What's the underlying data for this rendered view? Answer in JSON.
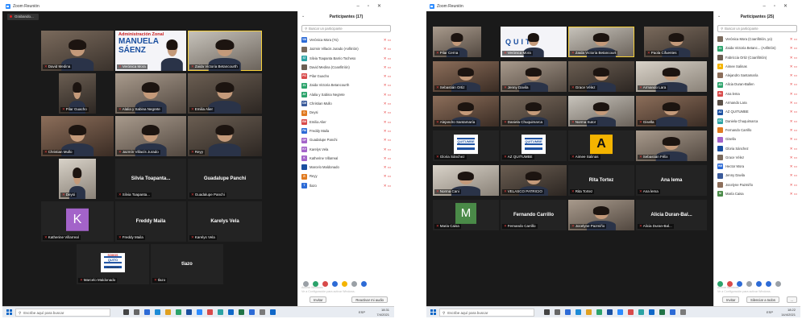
{
  "window": {
    "app_title": "Zoom Reunión",
    "minimize": "–",
    "maximize": "▫",
    "close": "✕"
  },
  "left": {
    "recording": "Grabando...",
    "participants_title": "Participantes (17)",
    "search_placeholder": "Buscar un participante",
    "tiles": [
      {
        "name": "David Medina"
      },
      {
        "name": "Verónica Mora",
        "banner": [
          "Administración Zonal",
          "MANUELA",
          "SÁENZ"
        ]
      },
      {
        "name": "Zaida Victoria Betancourth"
      },
      {
        "name": "Pilar Guacho"
      },
      {
        "name": "Alalia y Sabina Negrete"
      },
      {
        "name": "Emilia Alier"
      },
      {
        "name": "Christian Mullo"
      },
      {
        "name": "Jazmín Villacís Jurado"
      },
      {
        "name": "Reyy"
      },
      {
        "name": "Deysi"
      },
      {
        "name": "Silvia Toapanta..."
      },
      {
        "name": "Guadalupe Panchi"
      },
      {
        "name": "Katherine Villarreal",
        "initial": "K"
      },
      {
        "name": "Freddy Maila"
      },
      {
        "name": "Karelys Vela"
      },
      {
        "name": "Marcelo Maldonado",
        "logo": [
          "SOMOS",
          "QUITO",
          "ALANGASÍ"
        ]
      },
      {
        "name": "tlazo"
      }
    ],
    "participants": [
      {
        "initials": "VM",
        "name": "Verónica Mora (Yo)",
        "color": "#2d6bd6"
      },
      {
        "initials": "",
        "name": "Jazmin Villacis Jurado (Anfitrión)",
        "color": "#7a6a5c"
      },
      {
        "initials": "ST",
        "name": "Silvia Toapanta Barrio Tocheso",
        "color": "#2ba3a3"
      },
      {
        "initials": "",
        "name": "David Medina (Coanfitrión)",
        "color": "#6b5e52"
      },
      {
        "initials": "PG",
        "name": "Pilar Guacho",
        "color": "#d84a4a"
      },
      {
        "initials": "ZV",
        "name": "Zaida Victoria Betancourth",
        "color": "#2ba36b"
      },
      {
        "initials": "AY",
        "name": "Alalia y Sabina Negrete",
        "color": "#2ba36b"
      },
      {
        "initials": "CM",
        "name": "Christian Mullo",
        "color": "#3a5a9a"
      },
      {
        "initials": "D",
        "name": "Deysi",
        "color": "#e07a20"
      },
      {
        "initials": "EM",
        "name": "Emilia Alier",
        "color": "#d84a4a"
      },
      {
        "initials": "FM",
        "name": "Freddy Maila",
        "color": "#2d6bd6"
      },
      {
        "initials": "GP",
        "name": "Guadalupe Panchi",
        "color": "#a363c9"
      },
      {
        "initials": "KV",
        "name": "Karelys Vela",
        "color": "#a363c9"
      },
      {
        "initials": "K",
        "name": "Katherine Villarreal",
        "color": "#a363c9"
      },
      {
        "initials": "",
        "name": "Marcelo Maldonado",
        "color": "#1a4fa0"
      },
      {
        "initials": "R",
        "name": "Reyy",
        "color": "#e07a20"
      },
      {
        "initials": "T",
        "name": "tlazo",
        "color": "#2d6bd6"
      }
    ],
    "invite": "Invitar",
    "unmute_me": "Reactivar mi audio",
    "watermark": [
      "Activar Windows",
      "Ve a Configuración para activar Windows."
    ],
    "taskbar_search": "Escribe aquí para buscar",
    "tray_lang": "ESP",
    "time": "18:31",
    "date": "7/4/2021"
  },
  "right": {
    "participants_title": "Participantes (25)",
    "search_placeholder": "Buscar un participante",
    "tiles": [
      {
        "name": "Pilar Cerna"
      },
      {
        "name": "Verónica Mora",
        "quito": "QUITO"
      },
      {
        "name": "Zaida Victoria Betancourt"
      },
      {
        "name": "Paola Cifuentes"
      },
      {
        "name": "Sebastián Ortiz"
      },
      {
        "name": "Jenny Davila"
      },
      {
        "name": "Grace Vélez"
      },
      {
        "name": "Armando Lara"
      },
      {
        "name": "Alejandro Santamaría"
      },
      {
        "name": "Daniela Chuquimarca"
      },
      {
        "name": "Norma Sutor"
      },
      {
        "name": "Gisella"
      },
      {
        "name": "Gloria Sánchez",
        "logo": [
          "",
          "QUITUMBE",
          ""
        ]
      },
      {
        "name": "AZ QUITUMBE",
        "logo": [
          "",
          "QUITUMBE",
          ""
        ]
      },
      {
        "name": "Aimee Salinas",
        "initial": "A"
      },
      {
        "name": "Sebastián Félix"
      },
      {
        "name": "Norma Cani"
      },
      {
        "name": "VELASCO PATRICIO"
      },
      {
        "name": "Rita Tortez"
      },
      {
        "name": "Ana lema"
      },
      {
        "name": "Maria Caisa",
        "initial": "M"
      },
      {
        "name": "Fernando Carrillo"
      },
      {
        "name": "Jocelyne Pazmiño"
      },
      {
        "name": "Alicia Duran-Bal..."
      }
    ],
    "participants": [
      {
        "initials": "",
        "name": "Verónica Mora (Coanfitrión, yo)",
        "color": "#7a6a5c"
      },
      {
        "initials": "ZV",
        "name": "Zaida Victoria Betanc... (Anfitrión)",
        "color": "#2ba36b"
      },
      {
        "initials": "",
        "name": "Fabriccia Ortiz (Coanfitrión)",
        "color": "#6b5e52"
      },
      {
        "initials": "A",
        "name": "Aimee Salinas",
        "color": "#f4b400"
      },
      {
        "initials": "",
        "name": "Alejandro Santamaría",
        "color": "#8c6e5a"
      },
      {
        "initials": "AD",
        "name": "Alicia Duran-Ballen",
        "color": "#2ba36b"
      },
      {
        "initials": "AL",
        "name": "Ana lema",
        "color": "#d84a4a"
      },
      {
        "initials": "",
        "name": "Armando Lara",
        "color": "#5a5048"
      },
      {
        "initials": "AZ",
        "name": "AZ QUITUMBE",
        "color": "#1a4fa0"
      },
      {
        "initials": "DC",
        "name": "Daniela Chuquimarca",
        "color": "#2ba3a3"
      },
      {
        "initials": "",
        "name": "Fernando Carrillo",
        "color": "#e07a20"
      },
      {
        "initials": "",
        "name": "Gisella",
        "color": "#a363c9"
      },
      {
        "initials": "",
        "name": "Gloria Sánchez",
        "color": "#1a4fa0"
      },
      {
        "initials": "",
        "name": "Grace Vélez",
        "color": "#7a6a5c"
      },
      {
        "initials": "HM",
        "name": "Hector Mora",
        "color": "#2d6bd6"
      },
      {
        "initials": "",
        "name": "Jenny Davila",
        "color": "#3a5a9a"
      },
      {
        "initials": "",
        "name": "Jocelyne Pazmiño",
        "color": "#8c6e5a"
      },
      {
        "initials": "M",
        "name": "María Caisa",
        "color": "#4a8a48"
      }
    ],
    "invite": "Invitar",
    "mute_all": "Silenciar a todos",
    "more": "...",
    "watermark": [
      "Activar Windows",
      "Ve a Configuración para activar Windows."
    ],
    "taskbar_search": "Escribe aquí para buscar",
    "tray_lang": "ESP",
    "time": "18:22",
    "date": "14/4/2021"
  }
}
